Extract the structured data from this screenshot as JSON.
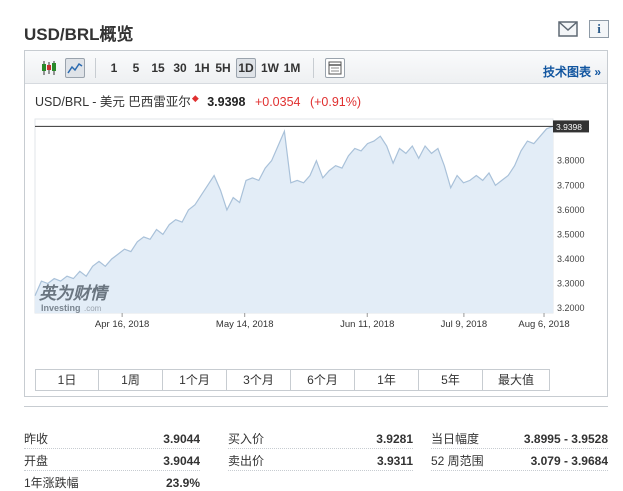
{
  "page": {
    "title": "USD/BRL概览",
    "icons": {
      "mail": "mail-icon",
      "info": "info-icon"
    }
  },
  "toolbar": {
    "chart_type_icons": [
      "candlestick-icon",
      "area-chart-icon"
    ],
    "timeframes": [
      "1",
      "5",
      "15",
      "30",
      "1H",
      "5H",
      "1D",
      "1W",
      "1M"
    ],
    "active_timeframe": "1D",
    "settings_icon": "chart-settings-icon",
    "tech_link": "技术图表 »"
  },
  "quote": {
    "symbol": "USD/BRL - 美元 巴西雷亚尔",
    "last": "3.9398",
    "change": "+0.0354",
    "change_pct": "(+0.91%)",
    "change_color": "#e03030"
  },
  "watermark": {
    "cn": "英为财情",
    "en": "Investing",
    "suffix": ".com"
  },
  "chart_data": {
    "type": "area",
    "x_ticks": [
      "Apr 16, 2018",
      "May 14, 2018",
      "Jun 11, 2018",
      "Jul 9, 2018",
      "Aug 6, 2018"
    ],
    "y_ticks": [
      "3.2000",
      "3.3000",
      "3.4000",
      "3.5000",
      "3.6000",
      "3.7000",
      "3.8000"
    ],
    "ylim": [
      3.18,
      3.97
    ],
    "last_label": "3.9398",
    "fill_color": "#e3edf7",
    "line_color": "#a9c1d9",
    "series": [
      {
        "values": [
          3.25,
          3.31,
          3.3,
          3.32,
          3.31,
          3.33,
          3.32,
          3.35,
          3.33,
          3.37,
          3.39,
          3.37,
          3.4,
          3.42,
          3.44,
          3.43,
          3.47,
          3.49,
          3.48,
          3.52,
          3.5,
          3.54,
          3.56,
          3.55,
          3.6,
          3.62,
          3.66,
          3.7,
          3.74,
          3.68,
          3.6,
          3.65,
          3.63,
          3.72,
          3.73,
          3.72,
          3.77,
          3.8,
          3.86,
          3.92,
          3.71,
          3.72,
          3.71,
          3.74,
          3.8,
          3.73,
          3.76,
          3.78,
          3.77,
          3.82,
          3.85,
          3.84,
          3.87,
          3.88,
          3.9,
          3.86,
          3.79,
          3.85,
          3.83,
          3.86,
          3.81,
          3.86,
          3.83,
          3.85,
          3.78,
          3.69,
          3.74,
          3.71,
          3.72,
          3.74,
          3.72,
          3.75,
          3.7,
          3.72,
          3.74,
          3.78,
          3.84,
          3.88,
          3.87,
          3.9,
          3.93,
          3.94
        ]
      }
    ]
  },
  "range_tabs": [
    "1日",
    "1周",
    "1个月",
    "3个月",
    "6个月",
    "1年",
    "5年",
    "最大值"
  ],
  "stats": {
    "prev_close_label": "昨收",
    "prev_close": "3.9044",
    "open_label": "开盘",
    "open": "3.9044",
    "year_change_label": "1年涨跌幅",
    "year_change": "23.9%",
    "bid_label": "买入价",
    "bid": "3.9281",
    "ask_label": "卖出价",
    "ask": "3.9311",
    "day_range_label": "当日幅度",
    "day_range": "3.8995 - 3.9528",
    "week52_label": "52 周范围",
    "week52": "3.079 - 3.9684"
  }
}
